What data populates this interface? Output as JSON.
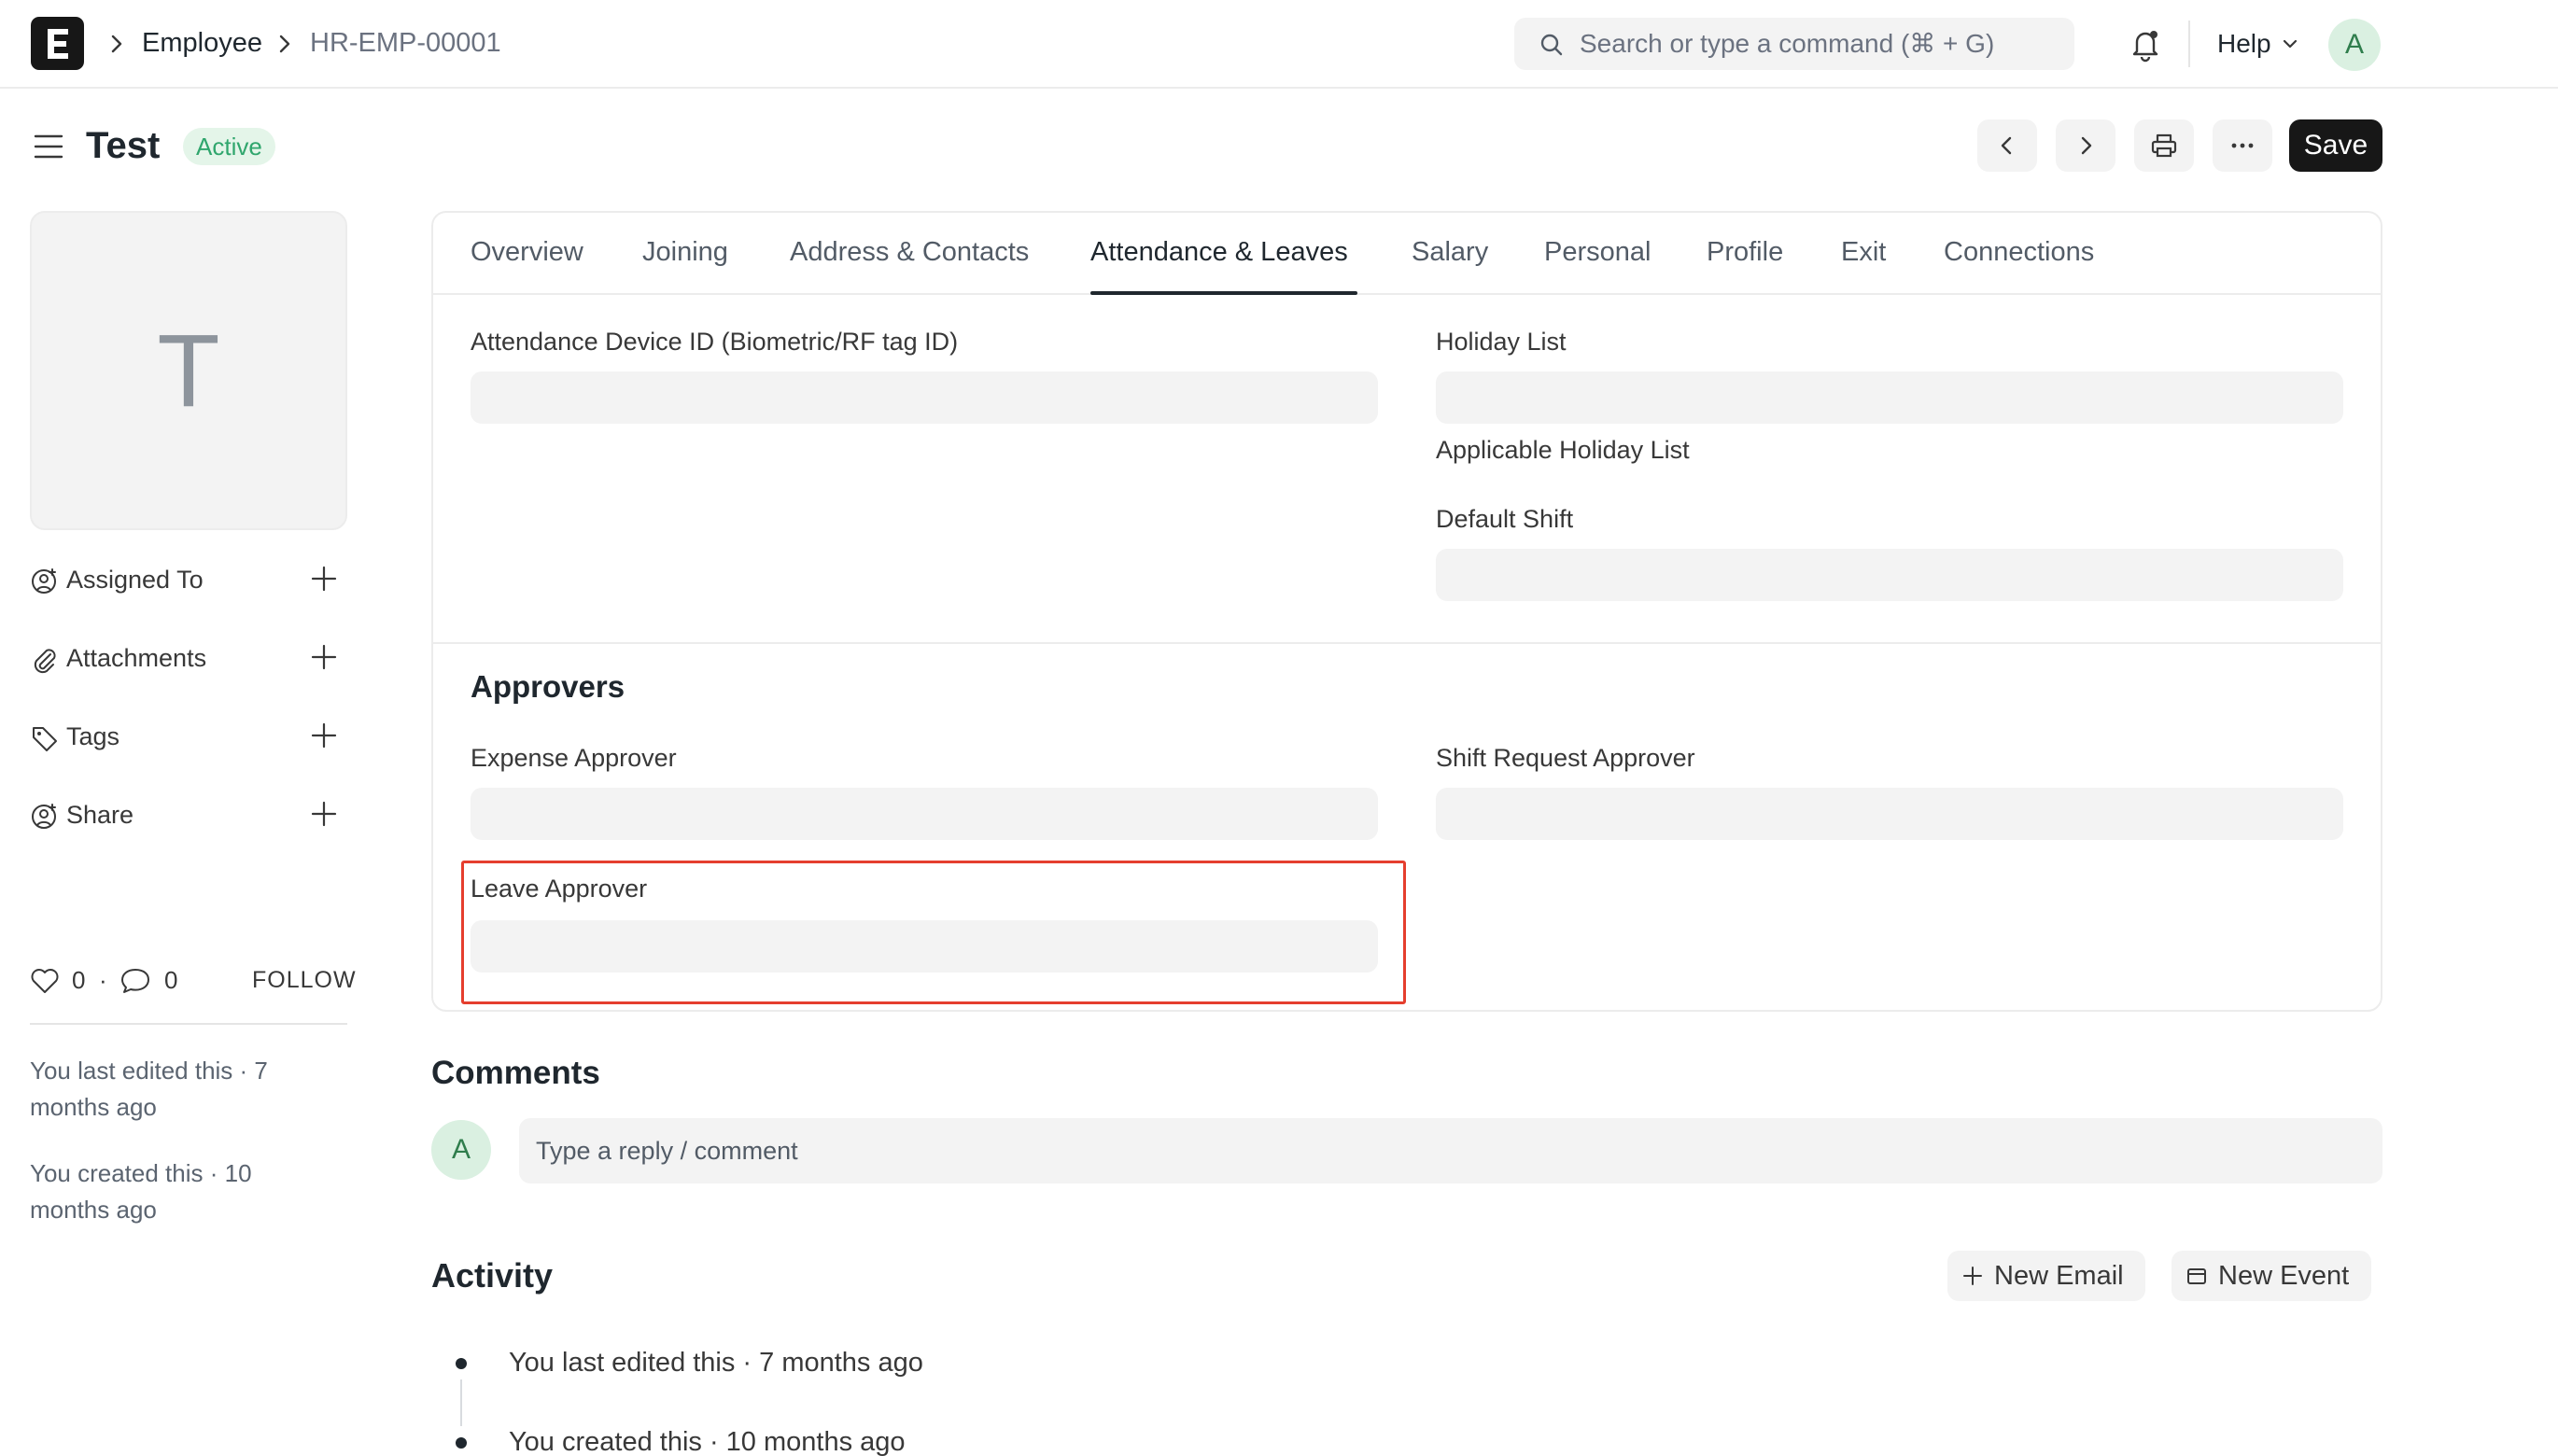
{
  "navbar": {
    "logo_letter": "E",
    "breadcrumbs": [
      "Employee",
      "HR-EMP-00001"
    ],
    "search_placeholder": "Search or type a command (⌘ + G)",
    "help_label": "Help",
    "user_initial": "A"
  },
  "page": {
    "title": "Test",
    "status": "Active",
    "save_label": "Save"
  },
  "sidebar": {
    "image_initial": "T",
    "items": [
      {
        "label": "Assigned To",
        "icon": "assign-user-icon"
      },
      {
        "label": "Attachments",
        "icon": "paperclip-icon"
      },
      {
        "label": "Tags",
        "icon": "tag-icon"
      },
      {
        "label": "Share",
        "icon": "share-user-icon"
      }
    ],
    "likes_count": "0",
    "separator": "·",
    "comments_count": "0",
    "follow_label": "FOLLOW",
    "last_edited": "You last edited this · 7 months ago",
    "created": "You created this · 10 months ago"
  },
  "tabs": [
    {
      "label": "Overview",
      "active": false
    },
    {
      "label": "Joining",
      "active": false
    },
    {
      "label": "Address & Contacts",
      "active": false
    },
    {
      "label": "Attendance & Leaves",
      "active": true
    },
    {
      "label": "Salary",
      "active": false
    },
    {
      "label": "Personal",
      "active": false
    },
    {
      "label": "Profile",
      "active": false
    },
    {
      "label": "Exit",
      "active": false
    },
    {
      "label": "Connections",
      "active": false
    }
  ],
  "form": {
    "attendance_device_label": "Attendance Device ID (Biometric/RF tag ID)",
    "attendance_device_value": "",
    "holiday_list_label": "Holiday List",
    "holiday_list_value": "",
    "applicable_holiday_list_label": "Applicable Holiday List",
    "default_shift_label": "Default Shift",
    "default_shift_value": "",
    "approvers_title": "Approvers",
    "expense_approver_label": "Expense Approver",
    "expense_approver_value": "",
    "shift_request_approver_label": "Shift Request Approver",
    "shift_request_approver_value": "",
    "leave_approver_label": "Leave Approver",
    "leave_approver_value": ""
  },
  "comments": {
    "title": "Comments",
    "avatar_initial": "A",
    "placeholder": "Type a reply / comment"
  },
  "activity": {
    "title": "Activity",
    "new_email_label": "New Email",
    "new_event_label": "New Event",
    "items": [
      "You last edited this · 7 months ago",
      "You created this · 10 months ago"
    ]
  },
  "colors": {
    "accent_dark": "#171717",
    "status_green": "#30a66d",
    "highlight_red": "#e53e2e",
    "field_bg": "#f3f3f3"
  }
}
